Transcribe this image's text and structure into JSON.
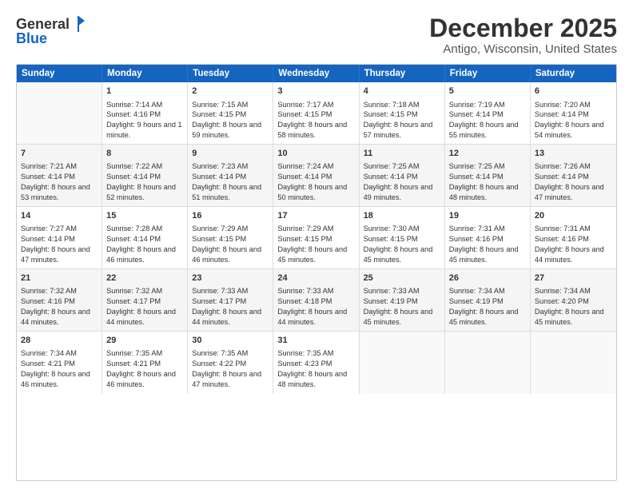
{
  "logo": {
    "general": "General",
    "blue": "Blue"
  },
  "header": {
    "month_year": "December 2025",
    "location": "Antigo, Wisconsin, United States"
  },
  "days_of_week": [
    "Sunday",
    "Monday",
    "Tuesday",
    "Wednesday",
    "Thursday",
    "Friday",
    "Saturday"
  ],
  "weeks": [
    [
      {
        "day": "",
        "sunrise": "",
        "sunset": "",
        "daylight": ""
      },
      {
        "day": "1",
        "sunrise": "Sunrise: 7:14 AM",
        "sunset": "Sunset: 4:16 PM",
        "daylight": "Daylight: 9 hours and 1 minute."
      },
      {
        "day": "2",
        "sunrise": "Sunrise: 7:15 AM",
        "sunset": "Sunset: 4:15 PM",
        "daylight": "Daylight: 8 hours and 59 minutes."
      },
      {
        "day": "3",
        "sunrise": "Sunrise: 7:17 AM",
        "sunset": "Sunset: 4:15 PM",
        "daylight": "Daylight: 8 hours and 58 minutes."
      },
      {
        "day": "4",
        "sunrise": "Sunrise: 7:18 AM",
        "sunset": "Sunset: 4:15 PM",
        "daylight": "Daylight: 8 hours and 57 minutes."
      },
      {
        "day": "5",
        "sunrise": "Sunrise: 7:19 AM",
        "sunset": "Sunset: 4:14 PM",
        "daylight": "Daylight: 8 hours and 55 minutes."
      },
      {
        "day": "6",
        "sunrise": "Sunrise: 7:20 AM",
        "sunset": "Sunset: 4:14 PM",
        "daylight": "Daylight: 8 hours and 54 minutes."
      }
    ],
    [
      {
        "day": "7",
        "sunrise": "Sunrise: 7:21 AM",
        "sunset": "Sunset: 4:14 PM",
        "daylight": "Daylight: 8 hours and 53 minutes."
      },
      {
        "day": "8",
        "sunrise": "Sunrise: 7:22 AM",
        "sunset": "Sunset: 4:14 PM",
        "daylight": "Daylight: 8 hours and 52 minutes."
      },
      {
        "day": "9",
        "sunrise": "Sunrise: 7:23 AM",
        "sunset": "Sunset: 4:14 PM",
        "daylight": "Daylight: 8 hours and 51 minutes."
      },
      {
        "day": "10",
        "sunrise": "Sunrise: 7:24 AM",
        "sunset": "Sunset: 4:14 PM",
        "daylight": "Daylight: 8 hours and 50 minutes."
      },
      {
        "day": "11",
        "sunrise": "Sunrise: 7:25 AM",
        "sunset": "Sunset: 4:14 PM",
        "daylight": "Daylight: 8 hours and 49 minutes."
      },
      {
        "day": "12",
        "sunrise": "Sunrise: 7:25 AM",
        "sunset": "Sunset: 4:14 PM",
        "daylight": "Daylight: 8 hours and 48 minutes."
      },
      {
        "day": "13",
        "sunrise": "Sunrise: 7:26 AM",
        "sunset": "Sunset: 4:14 PM",
        "daylight": "Daylight: 8 hours and 47 minutes."
      }
    ],
    [
      {
        "day": "14",
        "sunrise": "Sunrise: 7:27 AM",
        "sunset": "Sunset: 4:14 PM",
        "daylight": "Daylight: 8 hours and 47 minutes."
      },
      {
        "day": "15",
        "sunrise": "Sunrise: 7:28 AM",
        "sunset": "Sunset: 4:14 PM",
        "daylight": "Daylight: 8 hours and 46 minutes."
      },
      {
        "day": "16",
        "sunrise": "Sunrise: 7:29 AM",
        "sunset": "Sunset: 4:15 PM",
        "daylight": "Daylight: 8 hours and 46 minutes."
      },
      {
        "day": "17",
        "sunrise": "Sunrise: 7:29 AM",
        "sunset": "Sunset: 4:15 PM",
        "daylight": "Daylight: 8 hours and 45 minutes."
      },
      {
        "day": "18",
        "sunrise": "Sunrise: 7:30 AM",
        "sunset": "Sunset: 4:15 PM",
        "daylight": "Daylight: 8 hours and 45 minutes."
      },
      {
        "day": "19",
        "sunrise": "Sunrise: 7:31 AM",
        "sunset": "Sunset: 4:16 PM",
        "daylight": "Daylight: 8 hours and 45 minutes."
      },
      {
        "day": "20",
        "sunrise": "Sunrise: 7:31 AM",
        "sunset": "Sunset: 4:16 PM",
        "daylight": "Daylight: 8 hours and 44 minutes."
      }
    ],
    [
      {
        "day": "21",
        "sunrise": "Sunrise: 7:32 AM",
        "sunset": "Sunset: 4:16 PM",
        "daylight": "Daylight: 8 hours and 44 minutes."
      },
      {
        "day": "22",
        "sunrise": "Sunrise: 7:32 AM",
        "sunset": "Sunset: 4:17 PM",
        "daylight": "Daylight: 8 hours and 44 minutes."
      },
      {
        "day": "23",
        "sunrise": "Sunrise: 7:33 AM",
        "sunset": "Sunset: 4:17 PM",
        "daylight": "Daylight: 8 hours and 44 minutes."
      },
      {
        "day": "24",
        "sunrise": "Sunrise: 7:33 AM",
        "sunset": "Sunset: 4:18 PM",
        "daylight": "Daylight: 8 hours and 44 minutes."
      },
      {
        "day": "25",
        "sunrise": "Sunrise: 7:33 AM",
        "sunset": "Sunset: 4:19 PM",
        "daylight": "Daylight: 8 hours and 45 minutes."
      },
      {
        "day": "26",
        "sunrise": "Sunrise: 7:34 AM",
        "sunset": "Sunset: 4:19 PM",
        "daylight": "Daylight: 8 hours and 45 minutes."
      },
      {
        "day": "27",
        "sunrise": "Sunrise: 7:34 AM",
        "sunset": "Sunset: 4:20 PM",
        "daylight": "Daylight: 8 hours and 45 minutes."
      }
    ],
    [
      {
        "day": "28",
        "sunrise": "Sunrise: 7:34 AM",
        "sunset": "Sunset: 4:21 PM",
        "daylight": "Daylight: 8 hours and 46 minutes."
      },
      {
        "day": "29",
        "sunrise": "Sunrise: 7:35 AM",
        "sunset": "Sunset: 4:21 PM",
        "daylight": "Daylight: 8 hours and 46 minutes."
      },
      {
        "day": "30",
        "sunrise": "Sunrise: 7:35 AM",
        "sunset": "Sunset: 4:22 PM",
        "daylight": "Daylight: 8 hours and 47 minutes."
      },
      {
        "day": "31",
        "sunrise": "Sunrise: 7:35 AM",
        "sunset": "Sunset: 4:23 PM",
        "daylight": "Daylight: 8 hours and 48 minutes."
      },
      {
        "day": "",
        "sunrise": "",
        "sunset": "",
        "daylight": ""
      },
      {
        "day": "",
        "sunrise": "",
        "sunset": "",
        "daylight": ""
      },
      {
        "day": "",
        "sunrise": "",
        "sunset": "",
        "daylight": ""
      }
    ]
  ]
}
